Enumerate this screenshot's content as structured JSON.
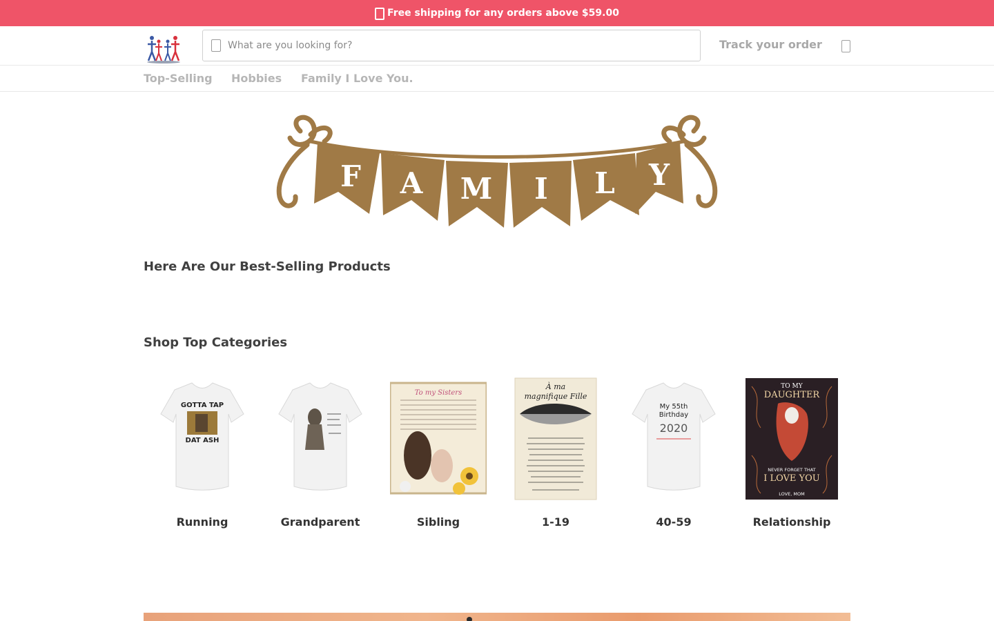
{
  "announcement": {
    "text": "Free shipping for any orders above $59.00",
    "icon": "shipping-icon"
  },
  "header": {
    "search_placeholder": "What are you looking for?",
    "track_label": "Track your order",
    "cart_icon": "cart-icon"
  },
  "nav": {
    "items": [
      {
        "label": "Top-Selling"
      },
      {
        "label": "Hobbies"
      },
      {
        "label": "Family I Love You."
      }
    ]
  },
  "banner": {
    "letters": [
      "F",
      "A",
      "M",
      "I",
      "L",
      "Y"
    ]
  },
  "sections": {
    "best_selling_title": "Here Are Our Best-Selling Products",
    "categories_title": "Shop Top Categories"
  },
  "categories": [
    {
      "label": "Running"
    },
    {
      "label": "Grandparent"
    },
    {
      "label": "Sibling"
    },
    {
      "label": "1-19"
    },
    {
      "label": "40-59"
    },
    {
      "label": "Relationship"
    }
  ],
  "product_art": {
    "running_shirt": [
      "GOTTA TAP",
      "DAT ASH"
    ],
    "birthday_shirt": [
      "My 55th",
      "Birthday",
      "2020"
    ],
    "blanket_daughter": [
      "TO MY",
      "DAUGHTER",
      "NEVER FORGET THAT",
      "I LOVE YOU",
      "LOVE, MOM"
    ],
    "poster_fille": [
      "À ma",
      "magnifique Fille"
    ],
    "blanket_sisters": [
      "To my Sisters"
    ]
  },
  "colors": {
    "announcement_bg": "#ef5468",
    "banner_brown": "#a07a46"
  }
}
